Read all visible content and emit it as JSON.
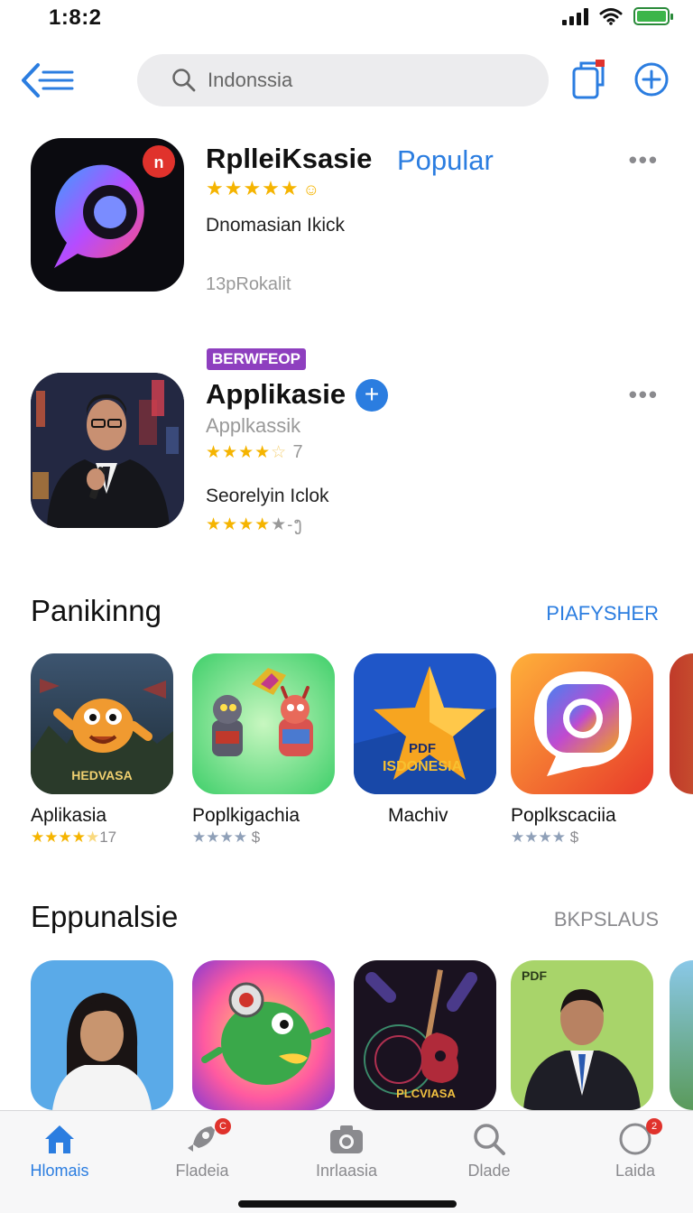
{
  "status": {
    "time": "1:8:2"
  },
  "search": {
    "placeholder": "Indonssia"
  },
  "featured": [
    {
      "title": "RplleiKsasie",
      "tag": "Popular",
      "subtitle": "Dnomasian Ikick",
      "meta": "13pRokalit",
      "rating": 5,
      "icon": "ring-chat-icon"
    },
    {
      "badge": "BERWFEOP",
      "title": "Applikasie",
      "developer": "Applkassik",
      "rating_count": "7",
      "subtitle": "Seorelyin Iclok",
      "rating2_count": "ງ",
      "rating": 4,
      "icon": "presenter-photo-icon"
    }
  ],
  "sections": [
    {
      "title": "Panikinng",
      "link": "PIAFYSHER",
      "link_color": "#2b7de0",
      "apps": [
        {
          "name": "Aplikasia",
          "count": "17",
          "icon": "monster-game-icon",
          "icon_text": "HEDVASA"
        },
        {
          "name": "Poplkigachia",
          "count": "$",
          "icon": "monsters-game-icon"
        },
        {
          "name": "Machiv",
          "count": "",
          "icon": "star-pdf-icon",
          "icon_text": "PDF",
          "icon_text2": "ISDONESIA"
        },
        {
          "name": "Poplkscaciia",
          "count": "$",
          "icon": "camera-chat-icon"
        }
      ]
    },
    {
      "title": "Eppunalsie",
      "link": "BKPSLAUS",
      "link_color": "#8a8a8e",
      "apps": [
        {
          "icon": "woman-portrait-icon"
        },
        {
          "icon": "robot-creature-icon"
        },
        {
          "icon": "guitar-music-icon",
          "icon_text": "PLCVIASA"
        },
        {
          "icon": "man-portrait-icon",
          "icon_text": "PDF"
        }
      ]
    }
  ],
  "tabs": [
    {
      "label": "Hlomais",
      "active": true,
      "icon": "home-icon"
    },
    {
      "label": "Fladeia",
      "badge": "C",
      "icon": "rocket-icon"
    },
    {
      "label": "Inrlaasia",
      "icon": "camera-icon"
    },
    {
      "label": "Dlade",
      "icon": "search-icon"
    },
    {
      "label": "Laida",
      "badge": "2",
      "icon": "profile-icon"
    }
  ],
  "colors": {
    "accent": "#2b7de0",
    "star": "#f5b400",
    "badge": "#8e3fbf"
  }
}
